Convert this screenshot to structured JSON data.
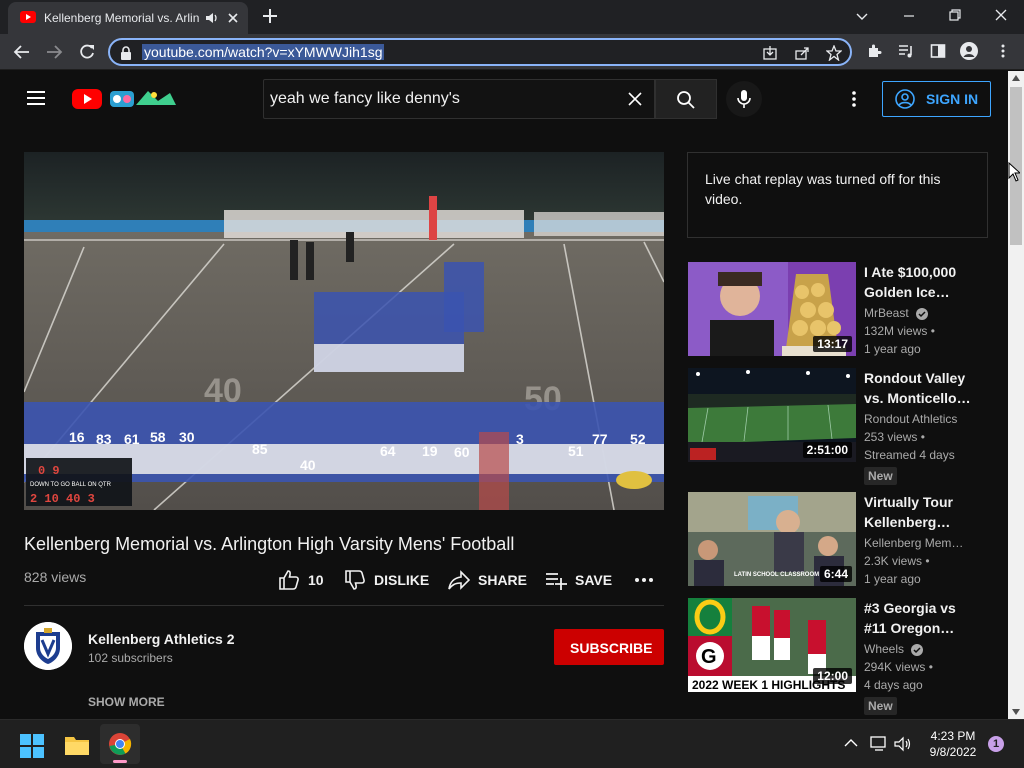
{
  "browser": {
    "tab_title": "Kellenberg Memorial vs. Arlin",
    "new_tab_label": "+",
    "url": "youtube.com/watch?v=xYMWWJih1sg"
  },
  "header": {
    "search_query": "yeah we fancy like denny's",
    "sign_in_label": "SIGN IN"
  },
  "video": {
    "title": "Kellenberg Memorial vs. Arlington High Varsity Mens' Football",
    "views": "828 views",
    "actions": {
      "like_count": "10",
      "dislike_label": "DISLIKE",
      "share_label": "SHARE",
      "save_label": "SAVE"
    },
    "scoreboard": {
      "row1": "0 9",
      "row2_labels": "DOWN TO GO BALL ON QTR",
      "row3": "2 10 40 3"
    },
    "yard_labels": [
      "40",
      "50"
    ]
  },
  "channel": {
    "name": "Kellenberg Athletics 2",
    "subscribers": "102 subscribers",
    "subscribe_label": "SUBSCRIBE",
    "show_more_label": "SHOW MORE"
  },
  "chat": {
    "message": "Live chat replay was turned off for this video."
  },
  "recommendations": [
    {
      "title": "I Ate $100,000 Golden Ice…",
      "channel": "MrBeast",
      "verified": true,
      "views": "132M views",
      "age": "1 year ago",
      "duration": "13:17",
      "badge": ""
    },
    {
      "title": "Rondout Valley vs. Monticello…",
      "channel": "Rondout Athletics",
      "verified": false,
      "views": "253 views",
      "age": "Streamed 4 days",
      "duration": "2:51:00",
      "badge": "New"
    },
    {
      "title": "Virtually Tour Kellenberg…",
      "channel": "Kellenberg Mem…",
      "verified": false,
      "views": "2.3K views",
      "age": "1 year ago",
      "duration": "6:44",
      "badge": "",
      "thumb_caption": "LATIN SCHOOL CLASSROOM"
    },
    {
      "title": "#3 Georgia vs #11 Oregon…",
      "channel": "Wheels",
      "verified": true,
      "views": "294K views",
      "age": "4 days ago",
      "duration": "12:00",
      "badge": "New",
      "thumb_caption": "2022 WEEK 1 HIGHLIGHTS"
    }
  ],
  "taskbar": {
    "time": "4:23 PM",
    "date": "9/8/2022",
    "notification_count": "1"
  },
  "colors": {
    "accent_blue": "#3ea6ff",
    "subscribe_red": "#cc0000",
    "youtube_red": "#ff0000"
  }
}
